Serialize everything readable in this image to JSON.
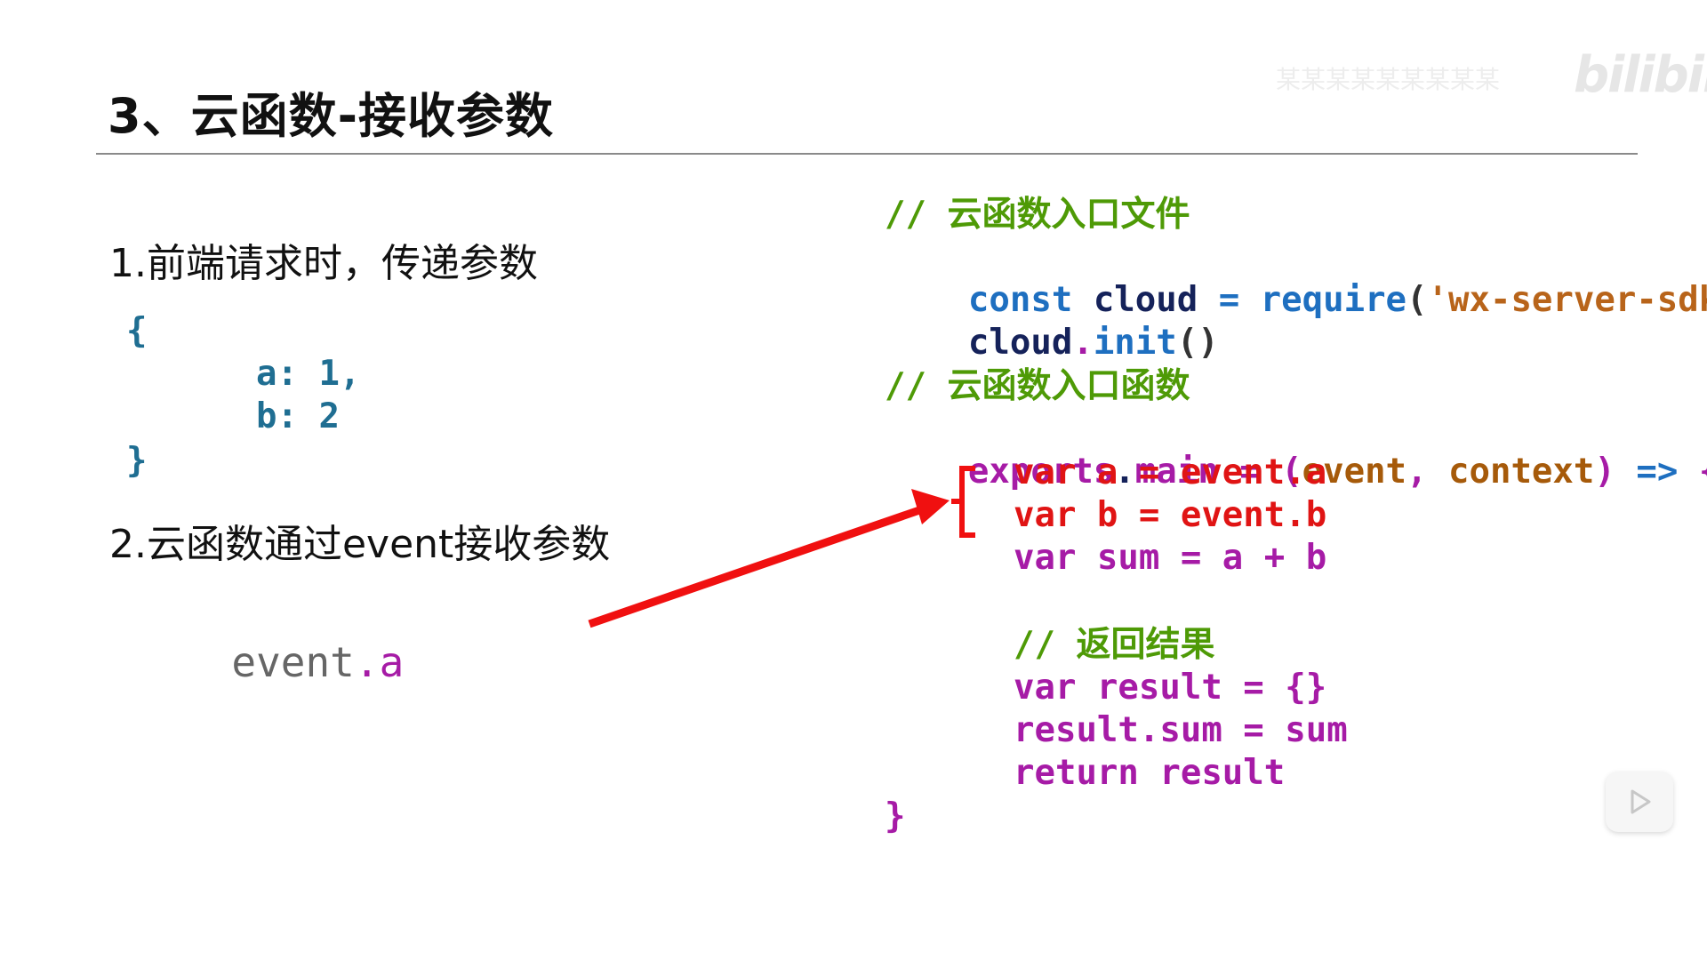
{
  "slide": {
    "title": "3、云函数-接收参数"
  },
  "watermark": {
    "text": "某某某某某某某某某",
    "logo": "bilibili"
  },
  "steps": {
    "step1": "1.前端请求时，传递参数",
    "step2": "2.云函数通过event接收参数"
  },
  "params_code": {
    "open": "{",
    "a_line": "a: 1,",
    "b_line": "b: 2",
    "close": "}"
  },
  "event_ref": {
    "object": "event",
    "property": ".a"
  },
  "code": {
    "comment_entry_file": "// 云函数入口文件",
    "require_line": {
      "kw": "const",
      "ident": "cloud",
      "eq": "=",
      "fn": "require",
      "lparen": "(",
      "str": "'wx-server-sdk'",
      "rparen": ")"
    },
    "init_line": {
      "obj": "cloud",
      "dot": ".",
      "fn": "init",
      "parens": "()"
    },
    "comment_entry_fn": "// 云函数入口函数",
    "main_line": {
      "exports": "exports",
      "dot": ".",
      "main": "main",
      "eq": "=",
      "lparen": "(",
      "event": "event",
      "comma": ",",
      "context": "context",
      "rparen": ")",
      "arrow": "=>",
      "brace": "{"
    },
    "var_a": "var a = event.a",
    "var_b": "var b = event.b",
    "var_sum": "var sum = a + b",
    "comment_return": "// 返回结果",
    "var_result": "var result = {}",
    "result_sum": "result.sum = sum",
    "return_line": "return result",
    "closing_brace": "}"
  },
  "colors": {
    "comment": "#4e9a06",
    "keyword": "#1e6fc0",
    "identifier": "#15225a",
    "string": "#b8641a",
    "purple": "#a61ba6",
    "param": "#a65a0a",
    "highlight": "#e01414",
    "params_teal": "#1f6e92",
    "arrow": "#f01010"
  },
  "icons": {
    "play": "play-icon"
  }
}
